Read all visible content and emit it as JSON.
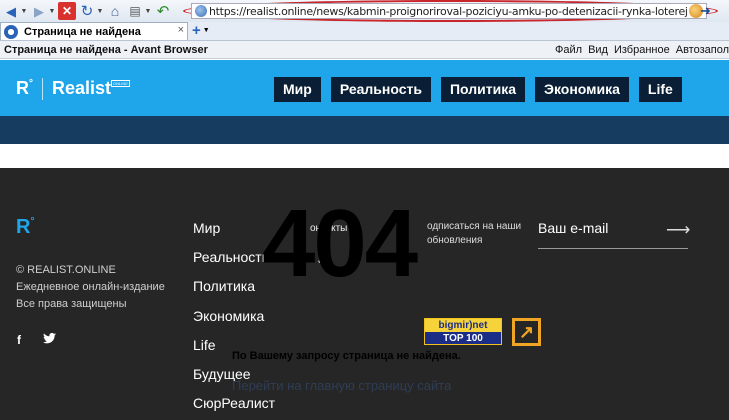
{
  "browser": {
    "address_url": "https://realist.online/news/kabmin-proignoriroval-poziciyu-amku-po-detenizacii-rynka-loterej",
    "tab_title": "Страница не найдена",
    "tab_close": "×",
    "new_tab": "+",
    "window_title": "Страница не найдена - Avant Browser",
    "menu": [
      "Файл",
      "Вид",
      "Избранное",
      "Автозапол"
    ]
  },
  "site": {
    "logo_letter": "R",
    "logo_degree": "°",
    "logo_name": "Realist",
    "logo_badge": "ONLINE",
    "nav": [
      "Мир",
      "Реальность",
      "Политика",
      "Экономика",
      "Life"
    ]
  },
  "footer": {
    "copyright": "© REALIST.ONLINE",
    "tagline": "Ежедневное онлайн-издание",
    "rights": "Все права защищены",
    "social": [
      "f",
      "t"
    ],
    "links": [
      "Мир",
      "Реальность",
      "Политика",
      "Экономика",
      "Life",
      "Будущее",
      "СюрРеалист"
    ],
    "contacts": "онтакты",
    "contacts_short": "а",
    "subscribe": "одписаться на наши обновления",
    "email_placeholder": "Ваш e-mail",
    "email_arrow": "⟶"
  },
  "error": {
    "code": "404",
    "message": "По Вашему запросу страница не найдена.",
    "home_link": "Перейти на главную страницу сайта"
  },
  "counter": {
    "brand": "bigmir)net",
    "label": "TOP 100",
    "ext_glyph": "↗"
  }
}
